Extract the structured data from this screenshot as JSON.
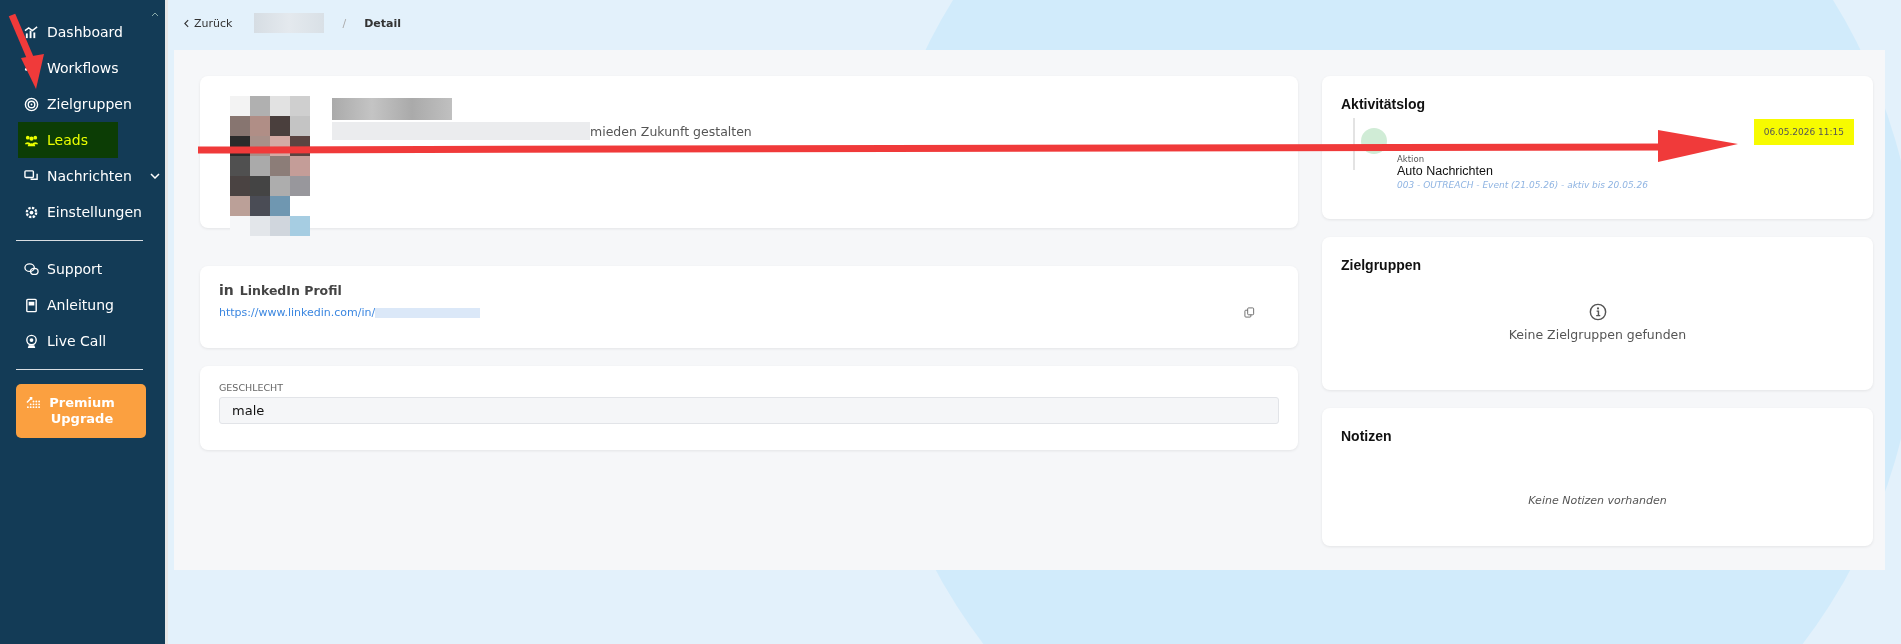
{
  "sidebar": {
    "groups": [
      [
        {
          "label": "Dashboard",
          "kind": "link",
          "selected": false
        },
        {
          "label": "Workflows",
          "kind": "link",
          "selected": false
        },
        {
          "label": "Zielgruppen",
          "kind": "link",
          "selected": false
        },
        {
          "label": "Leads",
          "kind": "link",
          "selected": true
        },
        {
          "label": "Nachrichten",
          "kind": "dropdown",
          "selected": false
        },
        {
          "label": "Einstellungen",
          "kind": "link",
          "selected": false
        }
      ],
      [
        {
          "label": "Support",
          "kind": "link",
          "selected": false
        },
        {
          "label": "Anleitung",
          "kind": "link",
          "selected": false
        },
        {
          "label": "Live Call",
          "kind": "link",
          "selected": false
        }
      ]
    ],
    "upgrade_button": "Premium Upgrade"
  },
  "breadcrumb": {
    "back": "Zurück",
    "separator": "/",
    "current": "Detail"
  },
  "profile": {
    "headline_visible": "mieden Zukunft gestalten"
  },
  "linkedin": {
    "logo": "in",
    "title": "LinkedIn Profil",
    "url_visible": "https://www.linkedin.com/in/"
  },
  "gender": {
    "label": "GESCHLECHT",
    "value": "male"
  },
  "activity_log": {
    "title": "Aktivitätslog",
    "entries": [
      {
        "type": "Aktion",
        "title": "Auto Nachrichten",
        "detail": "003 - OUTREACH - Event (21.05.26) - aktiv bis 20.05.26",
        "timestamp": "06.05.2026 11:15",
        "highlighted": true
      }
    ]
  },
  "target_groups": {
    "title": "Zielgruppen",
    "empty": "Keine Zielgruppen gefunden"
  },
  "notes": {
    "title": "Notizen",
    "empty": "Keine Notizen vorhanden"
  }
}
